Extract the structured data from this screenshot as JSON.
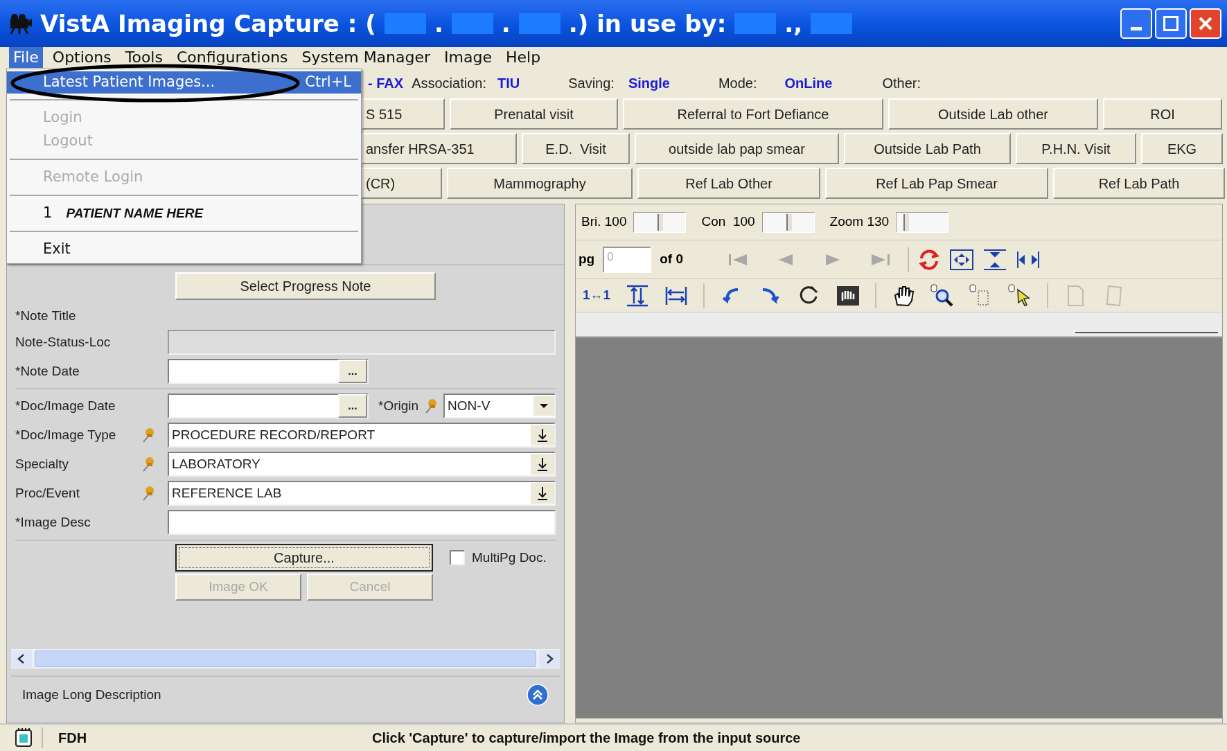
{
  "window": {
    "title_segments": [
      {
        "text": "VistA Imaging Capture :",
        "redacted_after": false
      },
      {
        "text": "(",
        "redacted_after": true
      },
      {
        "text": ".",
        "redacted_after": true
      },
      {
        "text": ".",
        "redacted_after": true
      },
      {
        "text": ".)",
        "redacted_after": false
      },
      {
        "text": "in use by:",
        "redacted_after": true
      },
      {
        "text": ".,",
        "redacted_after": true
      }
    ]
  },
  "menu": [
    {
      "label": "File",
      "selected": true
    },
    {
      "label": "Options",
      "selected": false
    },
    {
      "label": "Tools",
      "selected": false
    },
    {
      "label": "Configurations",
      "selected": false
    },
    {
      "label": "System Manager",
      "selected": false
    },
    {
      "label": "Image",
      "selected": false
    },
    {
      "label": "Help",
      "selected": false
    }
  ],
  "file_menu": [
    {
      "kind": "item",
      "label": "Latest Patient Images...",
      "shortcut": "Ctrl+L",
      "highlighted": true,
      "disabled": false
    },
    {
      "kind": "separator"
    },
    {
      "kind": "item",
      "label": "Login",
      "highlighted": false,
      "disabled": true
    },
    {
      "kind": "item",
      "label": "Logout",
      "highlighted": false,
      "disabled": true
    },
    {
      "kind": "separator"
    },
    {
      "kind": "item",
      "label": "Remote Login",
      "highlighted": false,
      "disabled": true
    },
    {
      "kind": "separator"
    },
    {
      "kind": "recent",
      "number": "1",
      "label": "PATIENT NAME HERE"
    },
    {
      "kind": "separator"
    },
    {
      "kind": "item",
      "label": "Exit",
      "highlighted": false,
      "disabled": false
    }
  ],
  "annotation": {
    "kind": "ellipse"
  },
  "info_bar": {
    "prefix": "- FAX",
    "association_label": "Association:",
    "association": "TIU",
    "saving_label": "Saving:",
    "saving": "Single",
    "mode_label": "Mode:",
    "mode": "OnLine",
    "other_label": "Other:"
  },
  "quick_buttons": [
    [
      "S 515",
      "Prenatal visit",
      "Referral to Fort Defiance",
      "Outside Lab other",
      "ROI"
    ],
    [
      "ansfer HRSA-351",
      "E.D.  Visit",
      "outside lab pap smear",
      "Outside Lab Path",
      "P.H.N. Visit",
      "EKG"
    ],
    [
      "(CR)",
      "Mammography",
      "Ref Lab Other",
      "Ref Lab Pap Smear",
      "Ref Lab Path"
    ]
  ],
  "form": {
    "select_note_button": "Select Progress Note",
    "rows": [
      {
        "kind": "label",
        "label": "*Note Title"
      },
      {
        "kind": "readonly",
        "label": "Note-Status-Loc"
      },
      {
        "kind": "date",
        "label": "*Note Date",
        "button": "..."
      },
      {
        "kind": "date_origin",
        "label": "*Doc/Image Date",
        "button": "...",
        "origin_label": "*Origin",
        "origin_value": "NON-V"
      },
      {
        "kind": "combo",
        "label": "*Doc/Image Type",
        "value": "PROCEDURE RECORD/REPORT"
      },
      {
        "kind": "combo",
        "label": "Specialty",
        "value": "LABORATORY"
      },
      {
        "kind": "combo",
        "label": "Proc/Event",
        "value": "REFERENCE LAB"
      },
      {
        "kind": "text",
        "label": "*Image Desc"
      }
    ],
    "capture_button": "Capture...",
    "multipage": {
      "label": "MultiPg Doc.",
      "checked": false
    },
    "image_ok_button": {
      "label": "Image OK",
      "disabled": true
    },
    "cancel_button": {
      "label": "Cancel",
      "disabled": true
    },
    "long_description": "Image Long Description"
  },
  "viewer": {
    "sliders": [
      {
        "label": "Bri. 100",
        "level": 0.5
      },
      {
        "label": "Con  100",
        "level": 0.5
      },
      {
        "label": "Zoom 130",
        "level": 0.15
      }
    ],
    "page_label": "pg",
    "page_value": "0",
    "page_of": "of 0",
    "page_nav_disabled": true,
    "actual_size": "1↔1"
  },
  "status_bar": {
    "user": "FDH",
    "message": "Click 'Capture' to capture/import the Image from the input source"
  }
}
